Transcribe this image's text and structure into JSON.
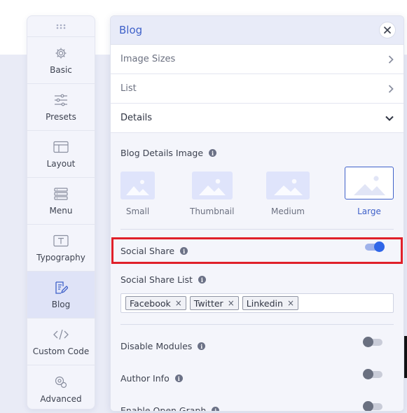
{
  "rail": {
    "items": [
      {
        "label": "Basic",
        "icon": "gear-icon"
      },
      {
        "label": "Presets",
        "icon": "sliders-icon"
      },
      {
        "label": "Layout",
        "icon": "layout-icon"
      },
      {
        "label": "Menu",
        "icon": "menu-icon"
      },
      {
        "label": "Typography",
        "icon": "typography-icon"
      },
      {
        "label": "Blog",
        "icon": "blog-icon",
        "active": true
      },
      {
        "label": "Custom Code",
        "icon": "code-icon"
      },
      {
        "label": "Advanced",
        "icon": "advanced-icon"
      }
    ]
  },
  "panel": {
    "title": "Blog",
    "sections": [
      {
        "label": "Image Sizes",
        "icon": "chevron-right-icon"
      },
      {
        "label": "List",
        "icon": "chevron-right-icon"
      },
      {
        "label": "Details",
        "icon": "chevron-down-icon",
        "open": true
      }
    ],
    "details": {
      "image_label": "Blog Details Image",
      "image_options": [
        {
          "label": "Small"
        },
        {
          "label": "Thumbnail"
        },
        {
          "label": "Medium"
        },
        {
          "label": "Large",
          "selected": true
        }
      ],
      "social_share_label": "Social Share",
      "social_share_on": true,
      "social_share_list_label": "Social Share List",
      "social_share_tags": [
        "Facebook",
        "Twitter",
        "Linkedin"
      ],
      "tag_remove_glyph": "×",
      "disable_modules_label": "Disable Modules",
      "author_info_label": "Author Info",
      "open_graph_label": "Enable Open Graph"
    }
  },
  "colors": {
    "accent": "#3f61c9",
    "toggle_on": "#2f66e8",
    "highlight": "#e0202a"
  }
}
